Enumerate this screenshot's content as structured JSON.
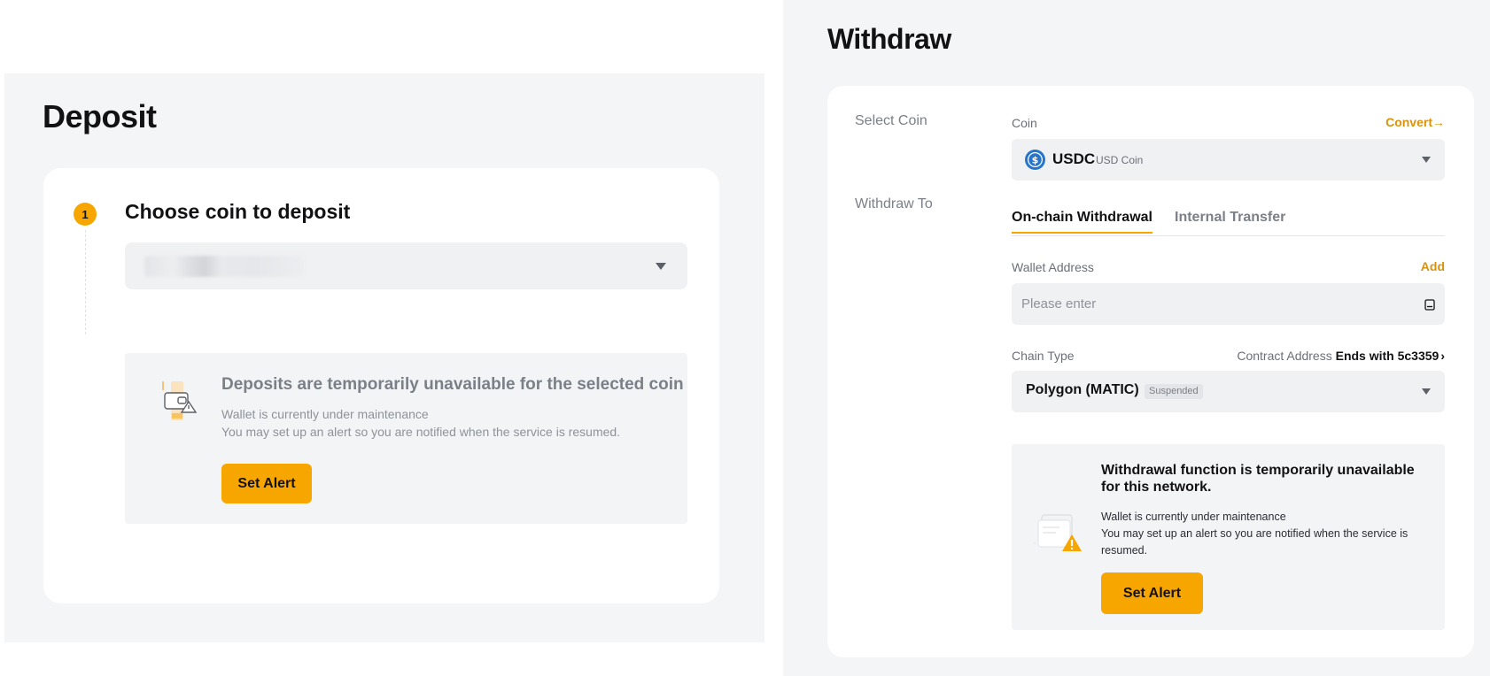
{
  "deposit": {
    "title": "Deposit",
    "step_number": "1",
    "step_title": "Choose coin to deposit",
    "notice": {
      "title": "Deposits are temporarily unavailable for the selected coin",
      "line1": "Wallet is currently under maintenance",
      "line2": "You may set up an alert so you are notified when the service is resumed.",
      "button": "Set Alert"
    }
  },
  "withdraw": {
    "title": "Withdraw",
    "select_coin_label": "Select Coin",
    "coin_field_label": "Coin",
    "convert_link": "Convert",
    "coin": {
      "symbol": "USDC",
      "name": "USD Coin"
    },
    "withdraw_to_label": "Withdraw To",
    "tabs": [
      {
        "label": "On-chain Withdrawal",
        "active": true
      },
      {
        "label": "Internal Transfer",
        "active": false
      }
    ],
    "wallet_address_label": "Wallet Address",
    "add_link": "Add",
    "wallet_address_placeholder": "Please enter",
    "chain_type_label": "Chain Type",
    "contract_address_label": "Contract Address",
    "contract_address_value": "Ends with 5c3359",
    "chain": {
      "name": "Polygon (MATIC)",
      "status": "Suspended"
    },
    "notice": {
      "title": "Withdrawal function is temporarily unavailable for this network.",
      "line1": "Wallet is currently under maintenance",
      "line2": "You may set up an alert so you are notified when the service is resumed.",
      "button": "Set Alert"
    }
  },
  "colors": {
    "accent": "#f7a600",
    "link": "#d9920a",
    "usdc_blue": "#2775ca",
    "panel_bg": "#f4f5f7"
  },
  "icons": [
    "step-badge",
    "chevron-down-icon",
    "wallet-maintenance-icon",
    "usdc-coin-icon",
    "arrow-right-icon",
    "address-book-icon",
    "chevron-right-icon",
    "card-warning-icon"
  ]
}
